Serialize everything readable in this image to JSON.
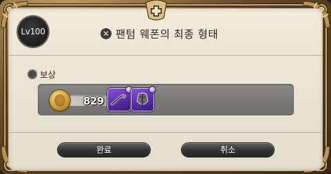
{
  "dialog": {
    "level_badge": "Lv100",
    "title_icon": "close-circle-icon",
    "title": "팬텀 웨폰의 최종 형태"
  },
  "rewards": {
    "label": "보상",
    "label_icon": "reward-icon",
    "gil": {
      "icon": "gil-coin-icon",
      "amount": "829"
    },
    "items": [
      {
        "icon": "weapon-item-icon",
        "rarity_color": "#7a44cc"
      },
      {
        "icon": "armor-item-icon",
        "rarity_color": "#7a44cc"
      }
    ]
  },
  "buttons": {
    "confirm_label": "완료",
    "cancel_label": "취소"
  },
  "colors": {
    "panel_background": "#ece5d7",
    "frame_gold": "#c9ad73",
    "button_dark": "#333333",
    "reward_box": "#7d7c79"
  }
}
